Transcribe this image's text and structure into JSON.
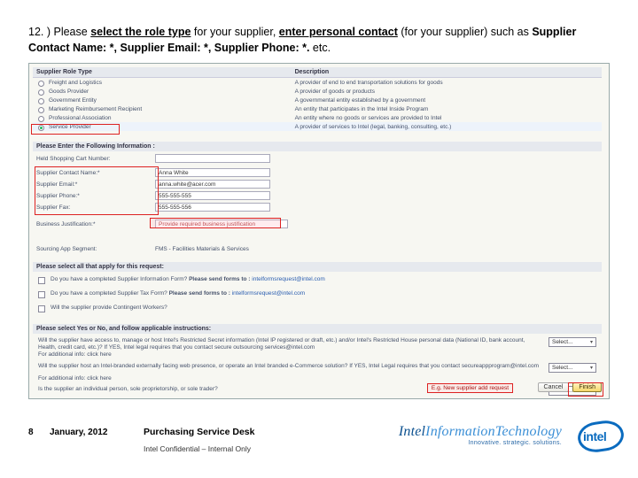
{
  "instruction": {
    "num": "12. ) Please ",
    "bold1": "select the role type",
    "mid1": " for your supplier, ",
    "bold2": "enter personal contact",
    "mid2": " (for your supplier) such as ",
    "bold3": "Supplier Contact Name: *, Supplier Email: *, Supplier Phone: *. ",
    "tail": "etc."
  },
  "roleTable": {
    "h1": "Supplier Role Type",
    "h2": "Description",
    "rows": [
      {
        "label": "Freight and Logistics",
        "desc": "A provider of end to end transportation solutions for goods"
      },
      {
        "label": "Goods Provider",
        "desc": "A provider of goods or products"
      },
      {
        "label": "Government Entity",
        "desc": "A governmental entity established by a government"
      },
      {
        "label": "Marketing Reimbursement Recipient",
        "desc": "An entity that participates in the Intel Inside Program"
      },
      {
        "label": "Professional Association",
        "desc": "An entity where no goods or services are provided to Intel"
      },
      {
        "label": "Service Provider",
        "desc": "A provider of services to Intel (legal, banking, consulting, etc.)"
      }
    ],
    "selectedIndex": 5
  },
  "sections": {
    "info": "Please Enter the Following Information :",
    "apply": "Please select all that apply for this request:",
    "yesno": "Please select Yes or No, and follow applicable instructions:"
  },
  "form": {
    "held": {
      "label": "Held Shopping Cart Number:",
      "value": ""
    },
    "contact": {
      "label": "Supplier Contact Name:*",
      "value": "Anna White"
    },
    "email": {
      "label": "Supplier Email:*",
      "value": "anna.white@acer.com"
    },
    "phone": {
      "label": "Supplier Phone:*",
      "value": "555-555-555"
    },
    "fax": {
      "label": "Supplier Fax:",
      "value": "555-555-556"
    },
    "justLabel": "Business Justification:*",
    "justValue": "Provide required business justification",
    "segLabel": "Sourcing App Segment:",
    "segValue": "FMS - Facilities Materials & Services"
  },
  "checks": {
    "q1a": "Do you have a completed Supplier Information Form?  ",
    "q1b": "Please send forms to : ",
    "q1link": "intelformsrequest@intel.com",
    "q2a": "Do you have a completed Supplier Tax Form?  ",
    "q2b": "Please send forms to : ",
    "q2link": "intelformsrequest@intel.com",
    "q3": "Will the supplier provide Contingent Workers?"
  },
  "yesno": {
    "r1": "Will the supplier have access to, manage or host Intel's Restricted Secret information (Intel IP registered or draft, etc.) and/or Intel's Restricted House personal data (National ID, bank account, Health, credit card, etc.)?  If YES, Intel legal requires that you contact secure outsourcing services@intel.com",
    "r1b": "For additional info: click here",
    "r2": "Will the supplier host an Intel-branded externally facing web presence, or operate an Intel branded e-Commerce solution?  If YES, Intel Legal requires that you contact secureappprogram@intel.com",
    "r2b": "For additional info: click here",
    "r3": "Is the supplier an individual person, sole proprietorship, or sole trader?",
    "selectLabel": "Select..."
  },
  "finish": {
    "hint": "E.g. New supplier add request",
    "cancel": "Cancel",
    "finish": "Finish"
  },
  "footer": {
    "page": "8",
    "date": "January, 2012",
    "psd": "Purchasing Service Desk",
    "conf": "Intel Confidential – Internal Only",
    "brand1": "Intel",
    "brand2": "InformationTechnology",
    "tagline": "Innovative. strategic. solutions.",
    "logoText": "intel"
  }
}
